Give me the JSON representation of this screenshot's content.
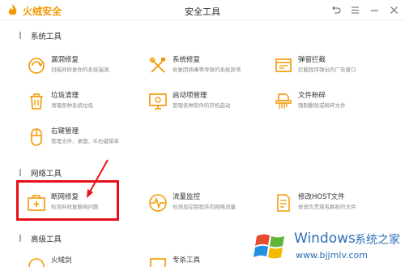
{
  "app": {
    "brand": "火绒安全",
    "title": "安全工具"
  },
  "colors": {
    "accent": "#f39800",
    "highlight": "#e8111a",
    "watermark": "#2a6fb5"
  },
  "sections": {
    "system": "系统工具",
    "network": "网络工具",
    "advanced": "高级工具"
  },
  "tools": {
    "vuln": {
      "name": "漏洞修复",
      "desc": "扫描并修复你的系统漏洞",
      "icon": "shield-refresh-icon"
    },
    "sysrepair": {
      "name": "系统修复",
      "desc": "修复因病毒等导致的系统异常",
      "icon": "wrench-screwdriver-icon"
    },
    "popup": {
      "name": "弹窗拦截",
      "desc": "拦截程序弹出的广告窗口",
      "icon": "window-block-icon"
    },
    "junk": {
      "name": "垃圾清理",
      "desc": "清理各种系统垃圾",
      "icon": "trash-icon"
    },
    "startup": {
      "name": "启动项管理",
      "desc": "管理各种软件的开机启动",
      "icon": "monitor-power-icon"
    },
    "shred": {
      "name": "文件粉碎",
      "desc": "强制删除或粉碎文件",
      "icon": "shredder-icon"
    },
    "rightclick": {
      "name": "右键管理",
      "desc": "管理文件、桌面、IE右键菜单",
      "icon": "mouse-icon"
    },
    "netrepair": {
      "name": "断网修复",
      "desc": "检测并修复断网问题",
      "icon": "toolbox-plus-icon"
    },
    "traffic": {
      "name": "流量监控",
      "desc": "检测及控制程序的网络流量",
      "icon": "pulse-icon"
    },
    "hosts": {
      "name": "修改HOST文件",
      "desc": "修改负责域名解析的文件",
      "icon": "document-edit-icon"
    },
    "adv1": {
      "name": "火绒剑",
      "icon": "adv-tool-icon"
    },
    "adv2": {
      "name": "专杀工具",
      "icon": "adv-tool-icon"
    }
  },
  "watermark": {
    "line1": "Windows",
    "line2": "系统之家",
    "url": "www.bjjmlv.com"
  }
}
